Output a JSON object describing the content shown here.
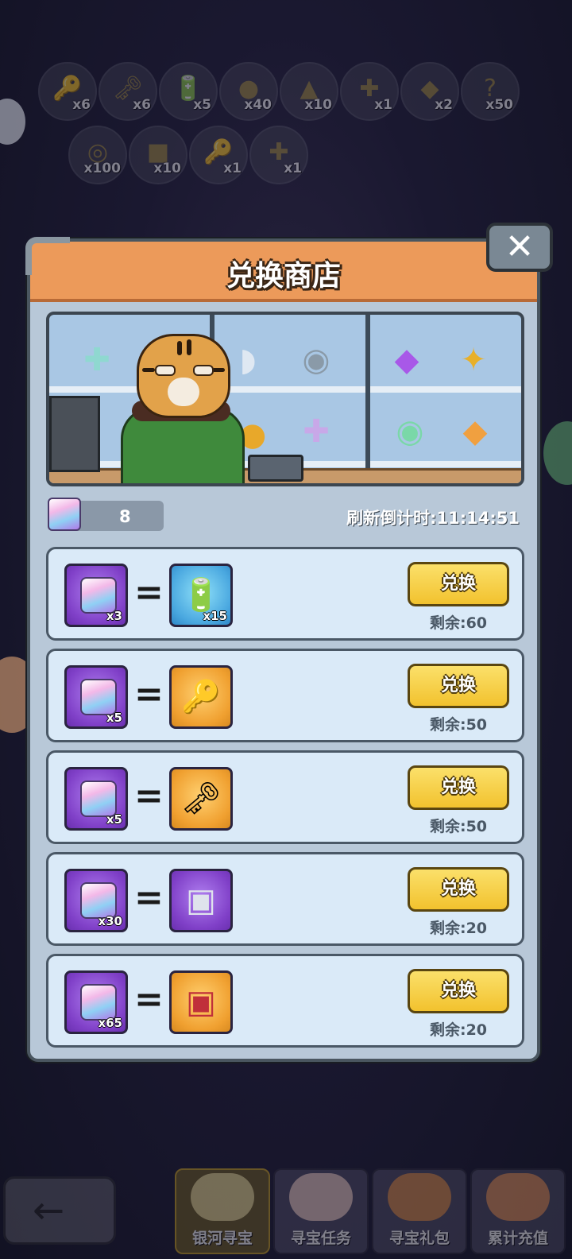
{
  "inventory": {
    "row1": [
      {
        "icon": "gold-key-icon",
        "glyph": "🔑",
        "count": "x6"
      },
      {
        "icon": "gem-key-icon",
        "glyph": "🗝",
        "count": "x6"
      },
      {
        "icon": "battery-icon",
        "glyph": "🔋",
        "count": "x5"
      },
      {
        "icon": "coin-pile-icon",
        "glyph": "●",
        "count": "x40"
      },
      {
        "icon": "arrowhead-icon",
        "glyph": "▲",
        "count": "x10"
      },
      {
        "icon": "puzzle-piece-icon",
        "glyph": "✚",
        "count": "x1"
      },
      {
        "icon": "purple-gem-icon",
        "glyph": "◆",
        "count": "x2"
      },
      {
        "icon": "mystery-box-icon",
        "glyph": "?",
        "count": "x50"
      }
    ],
    "row2": [
      {
        "icon": "coin-icon",
        "glyph": "◎",
        "count": "x100"
      },
      {
        "icon": "rainbow-cube-icon",
        "glyph": "■",
        "count": "x10"
      },
      {
        "icon": "silver-key-icon",
        "glyph": "🔑",
        "count": "x1"
      },
      {
        "icon": "puzzle-piece-icon",
        "glyph": "✚",
        "count": "x1"
      }
    ]
  },
  "modal": {
    "title": "兑换商店",
    "close_label": "✕",
    "currency_count": "8",
    "refresh_label": "刷新倒计时:11:14:51"
  },
  "offers": [
    {
      "cost": "x3",
      "reward_icon": "battery-icon",
      "reward_glyph": "🔋",
      "reward_qty": "x15",
      "reward_bg": "blue",
      "button": "兑换",
      "remaining": "剩余:60"
    },
    {
      "cost": "x5",
      "reward_icon": "gold-key-icon",
      "reward_glyph": "🔑",
      "reward_qty": "",
      "reward_bg": "gold",
      "button": "兑换",
      "remaining": "剩余:50"
    },
    {
      "cost": "x5",
      "reward_icon": "gem-key-icon",
      "reward_glyph": "🗝",
      "reward_qty": "",
      "reward_bg": "gold",
      "button": "兑换",
      "remaining": "剩余:50"
    },
    {
      "cost": "x30",
      "reward_icon": "purple-chest-icon",
      "reward_glyph": "▣",
      "reward_qty": "",
      "reward_bg": "purple",
      "button": "兑换",
      "remaining": "剩余:20"
    },
    {
      "cost": "x65",
      "reward_icon": "red-chest-icon",
      "reward_glyph": "▣",
      "reward_qty": "",
      "reward_bg": "gold",
      "button": "兑换",
      "remaining": "剩余:20"
    }
  ],
  "bottom_nav": {
    "back": "←",
    "tabs": [
      "银河寻宝",
      "寻宝任务",
      "寻宝礼包",
      "累计充值"
    ]
  }
}
